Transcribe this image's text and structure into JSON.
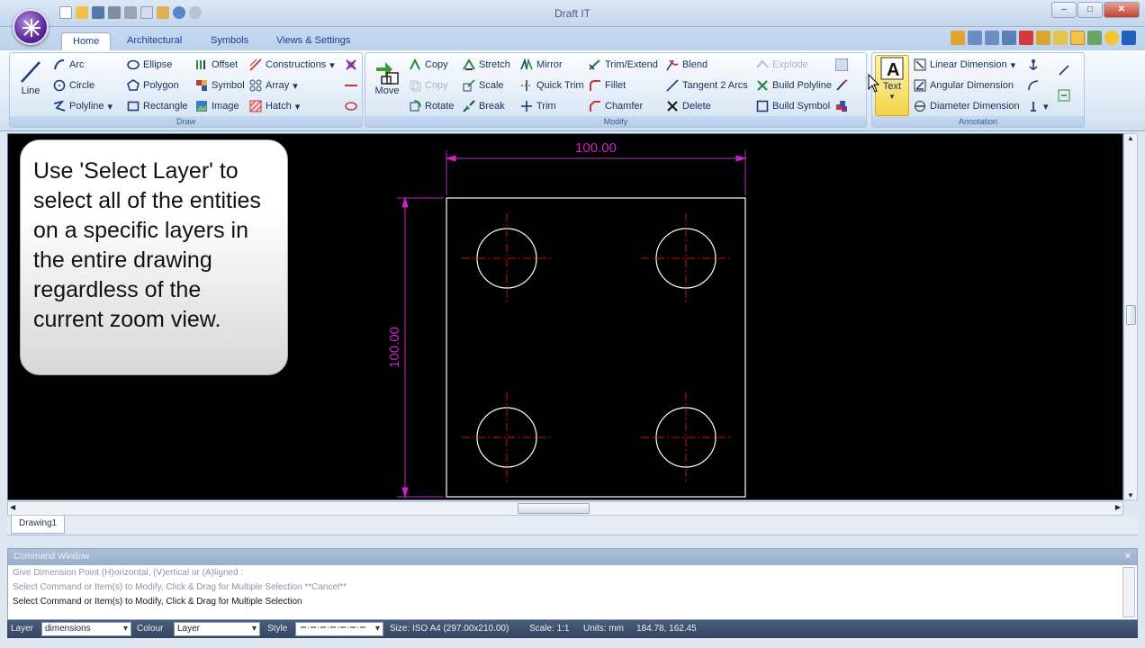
{
  "app": {
    "title": "Draft IT"
  },
  "tabs": [
    "Home",
    "Architectural",
    "Symbols",
    "Views & Settings"
  ],
  "ribbon": {
    "draw": {
      "label": "Draw",
      "line": "Line",
      "arc": "Arc",
      "circle": "Circle",
      "polyline": "Polyline",
      "ellipse": "Ellipse",
      "polygon": "Polygon",
      "rectangle": "Rectangle",
      "offset": "Offset",
      "symbol": "Symbol",
      "image": "Image",
      "constructions": "Constructions",
      "array": "Array",
      "hatch": "Hatch"
    },
    "modify": {
      "label": "Modify",
      "move": "Move",
      "copy": "Copy",
      "copy_disabled": "Copy",
      "rotate": "Rotate",
      "stretch": "Stretch",
      "scale": "Scale",
      "break": "Break",
      "mirror": "Mirror",
      "quick_trim": "Quick Trim",
      "trim": "Trim",
      "trim_extend": "Trim/Extend",
      "fillet": "Fillet",
      "chamfer": "Chamfer",
      "blend": "Blend",
      "tangent_2_arcs": "Tangent 2 Arcs",
      "delete": "Delete",
      "explode": "Explode",
      "build_polyline": "Build Polyline",
      "build_symbol": "Build Symbol"
    },
    "annotation": {
      "label": "Annotation",
      "text": "Text",
      "linear_dimension": "Linear Dimension",
      "angular_dimension": "Angular Dimension",
      "diameter_dimension": "Diameter Dimension"
    }
  },
  "drawing": {
    "dim_horizontal": "100.00",
    "dim_vertical": "100.00",
    "colors": {
      "outline": "#ffffff",
      "dimension": "#cc22cc",
      "centerline": "#cc1111"
    }
  },
  "callout": {
    "text": "Use 'Select Layer' to select all of the entities on a specific layers in the entire drawing regardless of the current zoom view."
  },
  "doc_tab": "Drawing1",
  "command_window": {
    "title": "Command Window",
    "lines": [
      "Give Dimension Point (H)orizontal, (V)ertical or (A)ligned :",
      "Select Command or Item(s) to Modify, Click & Drag for Multiple Selection  **Cancel**",
      "Select Command or Item(s) to Modify, Click & Drag for Multiple Selection"
    ]
  },
  "status": {
    "layer_label": "Layer",
    "layer_value": "dimensions",
    "colour_label": "Colour",
    "colour_value": "Layer",
    "style_label": "Style",
    "size": "Size: ISO A4 (297.00x210.00)",
    "scale": "Scale: 1:1",
    "units": "Units: mm",
    "coords": "184.78, 162.45"
  }
}
